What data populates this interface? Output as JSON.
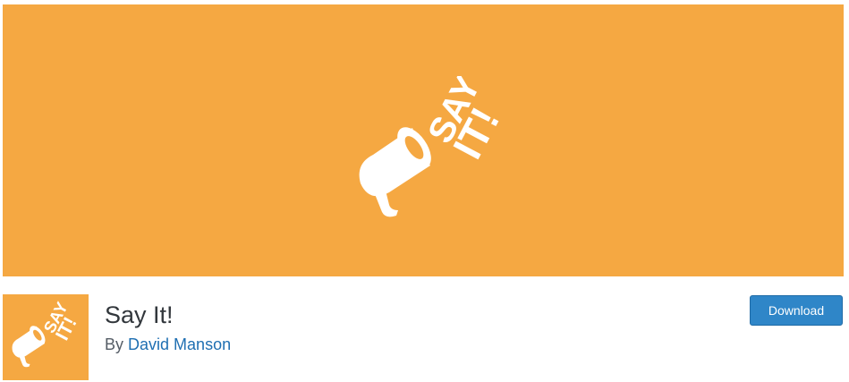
{
  "banner": {
    "logo_icon": "megaphone-icon",
    "logo_lines": [
      "SAY",
      "IT!"
    ]
  },
  "plugin": {
    "icon": "megaphone-icon",
    "icon_lines": [
      "SAY",
      "IT!"
    ],
    "title": "Say It!",
    "author_prefix": "By",
    "author_name": "David Manson",
    "download_label": "Download"
  },
  "colors": {
    "brand_orange": "#f5a842",
    "link_blue": "#1f6fb2",
    "button_blue": "#2f86c8",
    "title_text": "#32373c"
  }
}
